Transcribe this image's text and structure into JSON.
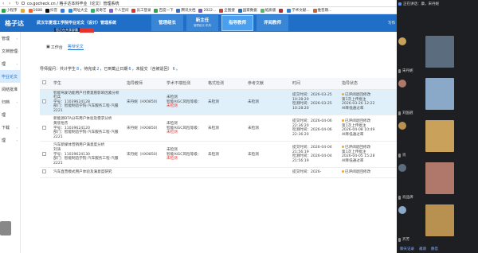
{
  "browser": {
    "url": "co.gocheck.cn / 格子达本科毕业（论文）管理系统"
  },
  "bookmarks": [
    "小程序",
    "",
    "1688",
    "抖音",
    "",
    "网址大全",
    "爱奇艺",
    "个人空间",
    "员工登录",
    "百度一下",
    "腾讯文档",
    "2022...",
    "全图搜",
    "国家数据",
    "纸质版",
    "",
    "学术文献...",
    "维普期..."
  ],
  "app": {
    "logo": "格子达",
    "title": "武汉华夏理工学院毕业论文（设计）管理系统",
    "banner": "您正在共享屏幕",
    "banner_stop": "结束共享",
    "nav": [
      {
        "label": "管理组长",
        "sub": ""
      },
      {
        "label": "新主任",
        "sub": "管理组长 机构"
      },
      {
        "label": "指导教师",
        "sub": "",
        "active": true
      },
      {
        "label": "评阅教师",
        "sub": ""
      }
    ],
    "write": "写作"
  },
  "sidebar": [
    {
      "label": "管理",
      "chev": "›"
    },
    {
      "label": "文档管理",
      "chev": "›"
    },
    {
      "label": "理",
      "chev": "›"
    },
    {
      "label": "毕业论文",
      "chev": "",
      "active": true
    },
    {
      "label": "阅结批准",
      "chev": ""
    },
    {
      "label": "归档",
      "chev": "›"
    },
    {
      "label": "理",
      "chev": ""
    },
    {
      "label": "下载",
      "chev": "›"
    },
    {
      "label": "理",
      "chev": "›"
    }
  ],
  "worktabs": [
    "工作台",
    "答辩论文"
  ],
  "summary": {
    "prefix": "导师提问：共计学生 ",
    "total": "8",
    "mid1": "，待完成 ",
    "pending": "2",
    "mid2": "，已到截止日期 ",
    "expired": "6",
    "mid3": "，未提交（含被退回）",
    "returned": "6",
    "suffix": "。"
  },
  "table": {
    "headers": [
      "",
      "学生",
      "指导教师",
      "学术不端检测",
      "格式检测",
      "参考文献",
      "时间",
      "指导状态"
    ],
    "rows": [
      {
        "title": "智能驾驶功能用户付费意愿影响因素分析",
        "name": "杜兵",
        "sid": "学号：11039624128",
        "dept": "部门：智能制造学院-汽车服务工程-汽服2221",
        "teacher": "宋丹妮（HX0850）",
        "check": "未检测",
        "aigc": "智能AIGC风险等级：",
        "aigc_v": "未检测",
        "fmt": "未检测",
        "ref": "未检测",
        "t1": "提交时间：2026-03-25 10:28:20",
        "t2": "检测时间：2026-03-25 10:28:20",
        "status": "已评阅退回修改",
        "s2": "第1次上传批注",
        "s3": "2026-03-26 12:22",
        "s4": "AI降低通过率",
        "hl": true
      },
      {
        "title": "新能源DTA分布用户体验及需求分析",
        "name": "黄欣怡杰",
        "sid": "学号：11039624120",
        "dept": "部门：智能制造学院-汽车服务工程-汽服2221",
        "teacher": "宋丹妮（HX0850）",
        "check": "未检测",
        "aigc": "智能AIGC风险等级：",
        "aigc_v": "未检测",
        "fmt": "未检测",
        "ref": "未检测",
        "t1": "提交时间：2026-04-06 22:36:20",
        "t2": "检测时间：2026-04-06 22:36:20",
        "status": "已评阅退回修改",
        "s2": "第1次上传批注",
        "s3": "2026-04-08 10:49",
        "s4": "AI降低通过率",
        "hl": false
      },
      {
        "title": "汽车新媒体营销用户满意度分析",
        "name": "刘涛",
        "sid": "学号：11039624130",
        "dept": "部门：智能制造学院-汽车服务工程-汽服2221",
        "teacher": "宋丹妮（HX0850）",
        "check": "未检测",
        "aigc": "智能AIGC风险等级：",
        "aigc_v": "未检测",
        "fmt": "未检测",
        "ref": "未检测",
        "t1": "提交时间：2026-04-04 21:56:19",
        "t2": "检测时间：2026-04-04 21:56:19",
        "status": "已评阅退回修改",
        "s2": "第1次上传批注",
        "s3": "2026-04-05 15:28",
        "s4": "AI降低通过率",
        "hl": false
      },
      {
        "title": "汽车直营模式用户体验及满意度研究",
        "name": "",
        "sid": "",
        "dept": "",
        "teacher": "",
        "check": "",
        "aigc": "",
        "aigc_v": "",
        "fmt": "",
        "ref": "",
        "t1": "提交时间：2026-",
        "t2": "",
        "status": "已评阅退回修改",
        "s2": "",
        "s3": "",
        "s4": "",
        "hl": false
      }
    ]
  },
  "meeting": {
    "top": "正在讲话：康，宋丹妮",
    "participants": [
      "宋丹妮",
      "刘国遐",
      "肖",
      "肖品牌",
      "齐芳"
    ],
    "footer": [
      "聊天记录",
      "邀请",
      "静音"
    ]
  },
  "colors": {
    "brand": "#1f6ec7",
    "accent": "#e5322d",
    "highlight": "#dff0fb"
  }
}
